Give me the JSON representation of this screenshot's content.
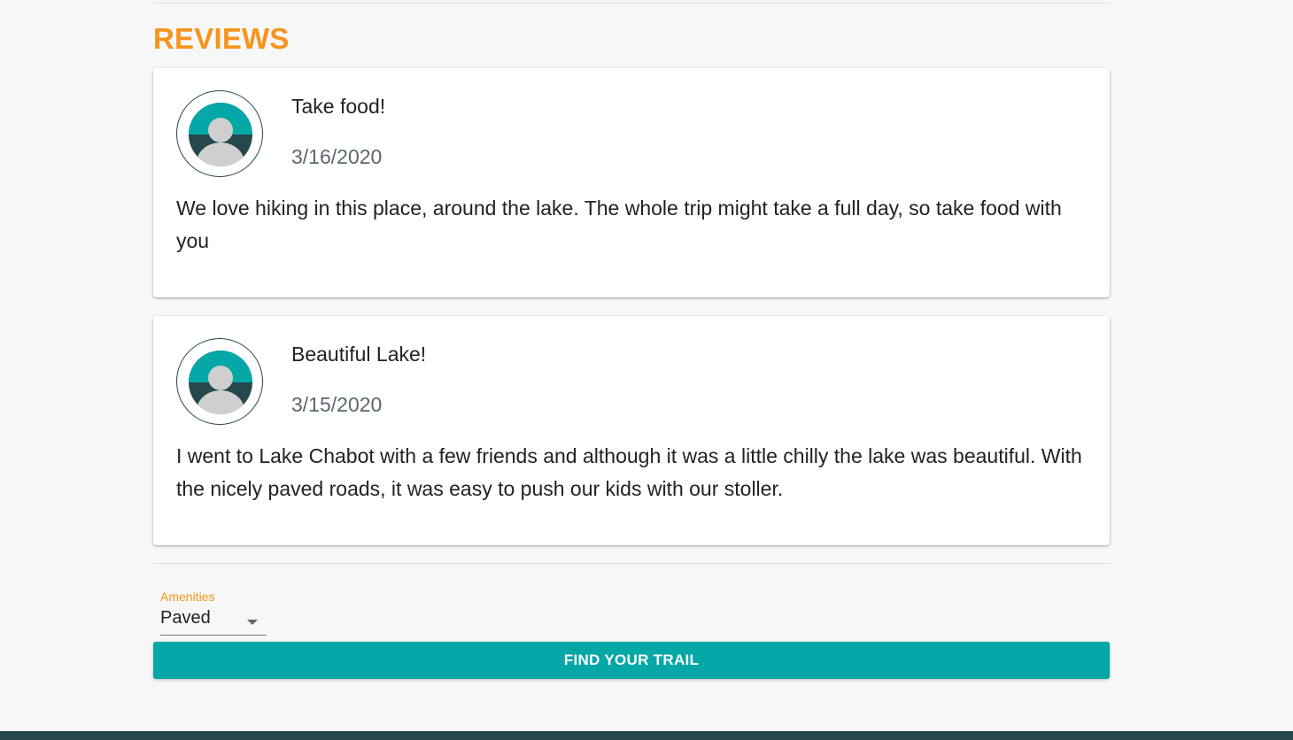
{
  "reviews": {
    "title": "REVIEWS",
    "items": [
      {
        "title": "Take food!",
        "date": "3/16/2020",
        "body": "We love hiking in this place, around the lake. The whole trip might take a full day, so take food with you"
      },
      {
        "title": "Beautiful Lake!",
        "date": "3/15/2020",
        "body": "I went to Lake Chabot with a few friends and although it was a little chilly the lake was beautiful. With the nicely paved roads, it was easy to push our kids with our stoller."
      }
    ]
  },
  "filter": {
    "label": "Amenities",
    "selected_value": "Paved",
    "icon": "chevron-down-icon"
  },
  "actions": {
    "find_label": "FIND YOUR TRAIL"
  },
  "colors": {
    "accent_orange": "#f7941d",
    "teal": "#05a7a7",
    "dark_teal": "#26474e"
  }
}
